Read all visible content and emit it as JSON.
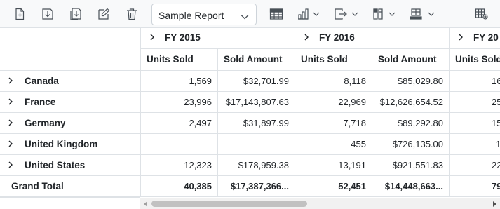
{
  "toolbar": {
    "report_select": {
      "value": "Sample Report"
    },
    "icons": [
      "new-report-icon",
      "save-icon",
      "save-as-icon",
      "rename-icon",
      "delete-icon",
      "grid-view-icon",
      "chart-icon",
      "export-icon",
      "subtotal-icon",
      "grand-total-icon",
      "format-icon"
    ]
  },
  "grid": {
    "years": [
      "FY 2015",
      "FY 2016",
      "FY 20"
    ],
    "measures": [
      "Units Sold",
      "Sold Amount",
      "Units Sold",
      "Sold Amount",
      "Units Sold"
    ],
    "rows": [
      {
        "label": "Canada",
        "values": [
          "1,569",
          "$32,701.99",
          "8,118",
          "$85,029.80",
          "16"
        ]
      },
      {
        "label": "France",
        "values": [
          "23,996",
          "$17,143,807.63",
          "22,969",
          "$12,626,654.52",
          "25"
        ]
      },
      {
        "label": "Germany",
        "values": [
          "2,497",
          "$31,897.99",
          "7,718",
          "$89,292.80",
          "15"
        ]
      },
      {
        "label": "United Kingdom",
        "values": [
          "",
          "",
          "455",
          "$726,135.00",
          "1"
        ]
      },
      {
        "label": "United States",
        "values": [
          "12,323",
          "$178,959.38",
          "13,191",
          "$921,551.83",
          "22"
        ]
      }
    ],
    "grand_total": {
      "label": "Grand Total",
      "values": [
        "40,385",
        "$17,387,366...",
        "52,451",
        "$14,448,663...",
        "79"
      ]
    }
  },
  "colors": {
    "border": "#dee2e6",
    "toolbar_bg": "#f8f9fa",
    "text": "#212529",
    "icon": "#495057"
  }
}
